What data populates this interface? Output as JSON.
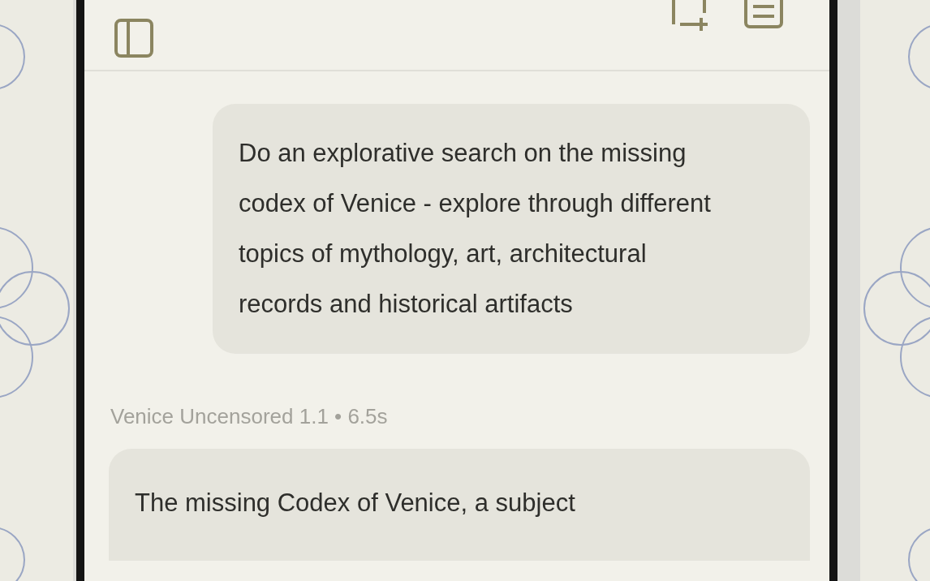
{
  "conversation": [
    {
      "kind": "user",
      "text": "Do an explorative search on the missing codex of Venice - explore through different topics of mythology, art, architectural records and historical artifacts"
    },
    {
      "kind": "meta",
      "text": "Venice Uncensored 1.1 • 6.5s"
    },
    {
      "kind": "assistant",
      "text": "The missing Codex of Venice, a subject"
    }
  ]
}
